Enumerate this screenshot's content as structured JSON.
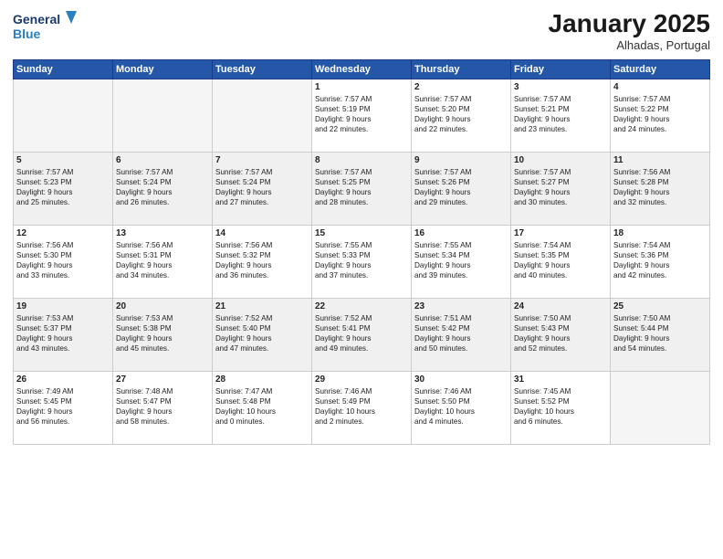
{
  "header": {
    "logo_line1": "General",
    "logo_line2": "Blue",
    "month": "January 2025",
    "location": "Alhadas, Portugal"
  },
  "weekdays": [
    "Sunday",
    "Monday",
    "Tuesday",
    "Wednesday",
    "Thursday",
    "Friday",
    "Saturday"
  ],
  "weeks": [
    {
      "days": [
        {
          "num": "",
          "info": ""
        },
        {
          "num": "",
          "info": ""
        },
        {
          "num": "",
          "info": ""
        },
        {
          "num": "1",
          "info": "Sunrise: 7:57 AM\nSunset: 5:19 PM\nDaylight: 9 hours\nand 22 minutes."
        },
        {
          "num": "2",
          "info": "Sunrise: 7:57 AM\nSunset: 5:20 PM\nDaylight: 9 hours\nand 22 minutes."
        },
        {
          "num": "3",
          "info": "Sunrise: 7:57 AM\nSunset: 5:21 PM\nDaylight: 9 hours\nand 23 minutes."
        },
        {
          "num": "4",
          "info": "Sunrise: 7:57 AM\nSunset: 5:22 PM\nDaylight: 9 hours\nand 24 minutes."
        }
      ]
    },
    {
      "days": [
        {
          "num": "5",
          "info": "Sunrise: 7:57 AM\nSunset: 5:23 PM\nDaylight: 9 hours\nand 25 minutes."
        },
        {
          "num": "6",
          "info": "Sunrise: 7:57 AM\nSunset: 5:24 PM\nDaylight: 9 hours\nand 26 minutes."
        },
        {
          "num": "7",
          "info": "Sunrise: 7:57 AM\nSunset: 5:24 PM\nDaylight: 9 hours\nand 27 minutes."
        },
        {
          "num": "8",
          "info": "Sunrise: 7:57 AM\nSunset: 5:25 PM\nDaylight: 9 hours\nand 28 minutes."
        },
        {
          "num": "9",
          "info": "Sunrise: 7:57 AM\nSunset: 5:26 PM\nDaylight: 9 hours\nand 29 minutes."
        },
        {
          "num": "10",
          "info": "Sunrise: 7:57 AM\nSunset: 5:27 PM\nDaylight: 9 hours\nand 30 minutes."
        },
        {
          "num": "11",
          "info": "Sunrise: 7:56 AM\nSunset: 5:28 PM\nDaylight: 9 hours\nand 32 minutes."
        }
      ]
    },
    {
      "days": [
        {
          "num": "12",
          "info": "Sunrise: 7:56 AM\nSunset: 5:30 PM\nDaylight: 9 hours\nand 33 minutes."
        },
        {
          "num": "13",
          "info": "Sunrise: 7:56 AM\nSunset: 5:31 PM\nDaylight: 9 hours\nand 34 minutes."
        },
        {
          "num": "14",
          "info": "Sunrise: 7:56 AM\nSunset: 5:32 PM\nDaylight: 9 hours\nand 36 minutes."
        },
        {
          "num": "15",
          "info": "Sunrise: 7:55 AM\nSunset: 5:33 PM\nDaylight: 9 hours\nand 37 minutes."
        },
        {
          "num": "16",
          "info": "Sunrise: 7:55 AM\nSunset: 5:34 PM\nDaylight: 9 hours\nand 39 minutes."
        },
        {
          "num": "17",
          "info": "Sunrise: 7:54 AM\nSunset: 5:35 PM\nDaylight: 9 hours\nand 40 minutes."
        },
        {
          "num": "18",
          "info": "Sunrise: 7:54 AM\nSunset: 5:36 PM\nDaylight: 9 hours\nand 42 minutes."
        }
      ]
    },
    {
      "days": [
        {
          "num": "19",
          "info": "Sunrise: 7:53 AM\nSunset: 5:37 PM\nDaylight: 9 hours\nand 43 minutes."
        },
        {
          "num": "20",
          "info": "Sunrise: 7:53 AM\nSunset: 5:38 PM\nDaylight: 9 hours\nand 45 minutes."
        },
        {
          "num": "21",
          "info": "Sunrise: 7:52 AM\nSunset: 5:40 PM\nDaylight: 9 hours\nand 47 minutes."
        },
        {
          "num": "22",
          "info": "Sunrise: 7:52 AM\nSunset: 5:41 PM\nDaylight: 9 hours\nand 49 minutes."
        },
        {
          "num": "23",
          "info": "Sunrise: 7:51 AM\nSunset: 5:42 PM\nDaylight: 9 hours\nand 50 minutes."
        },
        {
          "num": "24",
          "info": "Sunrise: 7:50 AM\nSunset: 5:43 PM\nDaylight: 9 hours\nand 52 minutes."
        },
        {
          "num": "25",
          "info": "Sunrise: 7:50 AM\nSunset: 5:44 PM\nDaylight: 9 hours\nand 54 minutes."
        }
      ]
    },
    {
      "days": [
        {
          "num": "26",
          "info": "Sunrise: 7:49 AM\nSunset: 5:45 PM\nDaylight: 9 hours\nand 56 minutes."
        },
        {
          "num": "27",
          "info": "Sunrise: 7:48 AM\nSunset: 5:47 PM\nDaylight: 9 hours\nand 58 minutes."
        },
        {
          "num": "28",
          "info": "Sunrise: 7:47 AM\nSunset: 5:48 PM\nDaylight: 10 hours\nand 0 minutes."
        },
        {
          "num": "29",
          "info": "Sunrise: 7:46 AM\nSunset: 5:49 PM\nDaylight: 10 hours\nand 2 minutes."
        },
        {
          "num": "30",
          "info": "Sunrise: 7:46 AM\nSunset: 5:50 PM\nDaylight: 10 hours\nand 4 minutes."
        },
        {
          "num": "31",
          "info": "Sunrise: 7:45 AM\nSunset: 5:52 PM\nDaylight: 10 hours\nand 6 minutes."
        },
        {
          "num": "",
          "info": ""
        }
      ]
    }
  ]
}
